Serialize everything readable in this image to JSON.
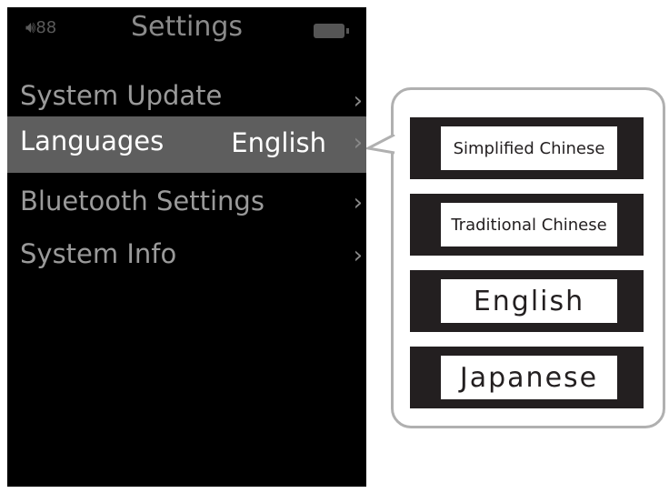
{
  "header": {
    "title": "Settings",
    "volume": "88"
  },
  "menu": [
    {
      "label": "System Update",
      "value": ""
    },
    {
      "label": "Languages",
      "value": "English"
    },
    {
      "label": "Bluetooth Settings",
      "value": ""
    },
    {
      "label": "System Info",
      "value": ""
    }
  ],
  "languages": [
    "Simplified Chinese",
    "Traditional Chinese",
    "English",
    "Japanese"
  ]
}
